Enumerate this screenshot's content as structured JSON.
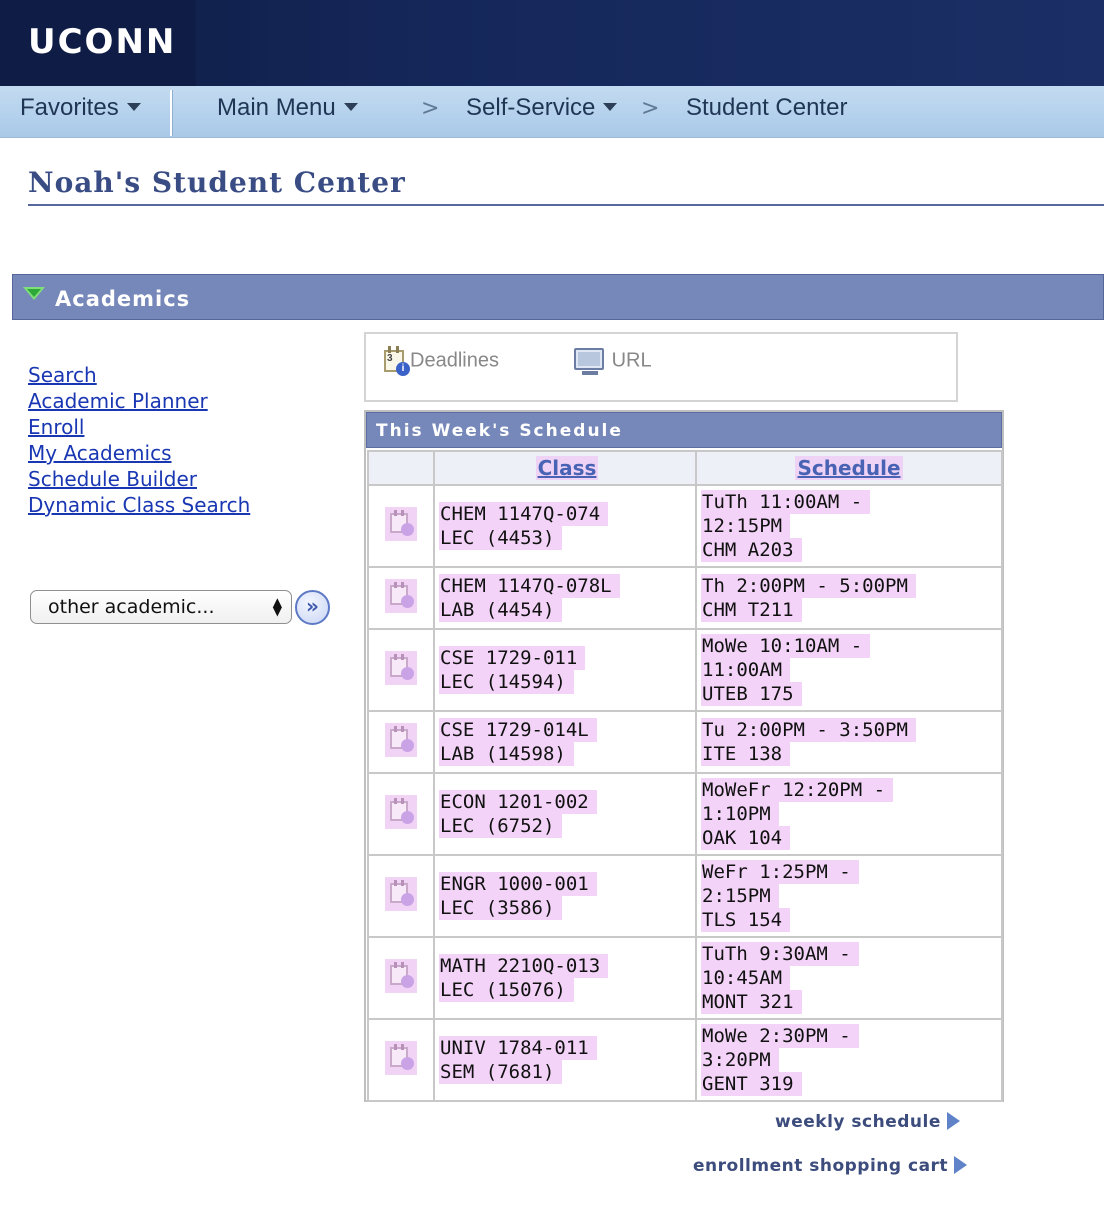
{
  "header": {
    "logo_text": "UCONN"
  },
  "nav": {
    "favorites": "Favorites",
    "main_menu": "Main Menu",
    "sep": ">",
    "self_service": "Self-Service",
    "student_center": "Student Center"
  },
  "page_title": "Noah's Student Center",
  "section": {
    "title": "Academics"
  },
  "left_links": [
    "Search",
    "Academic Planner",
    "Enroll",
    "My Academics",
    "Schedule Builder",
    "Dynamic Class Search"
  ],
  "select": {
    "value": "other academic...",
    "go_icon": "double-chevron-right-icon"
  },
  "quick_links": {
    "deadlines": "Deadlines",
    "url": "URL"
  },
  "schedule": {
    "title": "This Week's Schedule",
    "col_class": "Class",
    "col_schedule": "Schedule",
    "rows": [
      {
        "class": [
          "CHEM 1147Q-074",
          "LEC (4453)"
        ],
        "schedule": [
          "TuTh 11:00AM -",
          "12:15PM",
          "CHM A203"
        ]
      },
      {
        "class": [
          "CHEM 1147Q-078L",
          "LAB (4454)"
        ],
        "schedule": [
          "Th 2:00PM - 5:00PM",
          "CHM T211"
        ]
      },
      {
        "class": [
          "CSE 1729-011",
          "LEC (14594)"
        ],
        "schedule": [
          "MoWe 10:10AM -",
          "11:00AM",
          "UTEB 175"
        ]
      },
      {
        "class": [
          "CSE 1729-014L",
          "LAB (14598)"
        ],
        "schedule": [
          "Tu 2:00PM - 3:50PM",
          "ITE 138"
        ]
      },
      {
        "class": [
          "ECON 1201-002",
          "LEC (6752)"
        ],
        "schedule": [
          "MoWeFr 12:20PM -",
          "1:10PM",
          "OAK 104"
        ]
      },
      {
        "class": [
          "ENGR 1000-001",
          "LEC (3586)"
        ],
        "schedule": [
          "WeFr 1:25PM -",
          "2:15PM",
          "TLS 154"
        ]
      },
      {
        "class": [
          "MATH 2210Q-013",
          "LEC (15076)"
        ],
        "schedule": [
          "TuTh 9:30AM -",
          "10:45AM",
          "MONT 321"
        ]
      },
      {
        "class": [
          "UNIV 1784-011",
          "SEM (7681)"
        ],
        "schedule": [
          "MoWe 2:30PM -",
          "3:20PM",
          "GENT 319"
        ]
      }
    ]
  },
  "footer_links": {
    "weekly": "weekly schedule",
    "cart": "enrollment shopping cart"
  }
}
